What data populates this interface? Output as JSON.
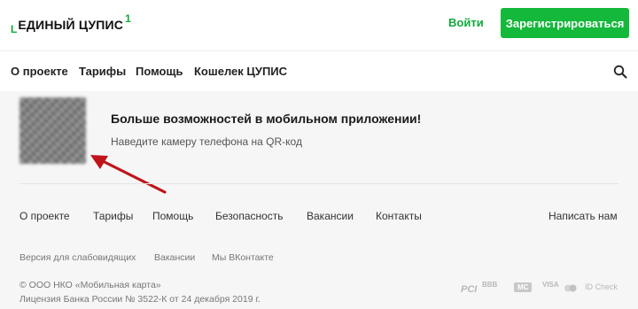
{
  "header": {
    "logo_prefix": "L",
    "logo_text": "ЕДИНЫЙ ЦУПИС",
    "logo_sup": "1",
    "login_label": "Войти",
    "register_label": "Зарегистрироваться"
  },
  "nav": {
    "items": [
      "О проекте",
      "Тарифы",
      "Помощь",
      "Кошелек ЦУПИС"
    ],
    "search_icon": "search-icon"
  },
  "promo": {
    "title": "Больше возможностей в мобильном приложении!",
    "subtitle": "Наведите камеру телефона на QR-код"
  },
  "footer": {
    "links": [
      "О проекте",
      "Тарифы",
      "Помощь",
      "Безопасность",
      "Вакансии",
      "Контакты"
    ],
    "write_us": "Написать нам",
    "small_links": [
      "Версия для слабовидящих",
      "Вакансии",
      "Мы ВКонтакте"
    ],
    "copyright": "© ООО НКО «Мобильная карта»",
    "license": "Лицензия Банка России № 3522-К от 24 декабря 2019 г.",
    "badges": [
      "PCI",
      "BBB",
      "MC",
      "VISA",
      "ID Check"
    ]
  },
  "colors": {
    "accent": "#14b83a",
    "arrow": "#c0141a"
  }
}
